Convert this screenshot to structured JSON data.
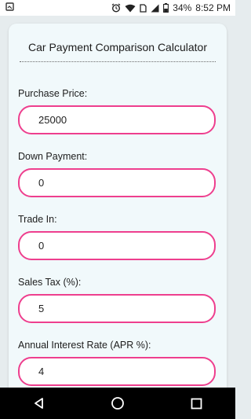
{
  "status_bar": {
    "battery_percent": "34%",
    "time": "8:52 PM",
    "icons": [
      "notification-icon",
      "alarm-icon",
      "wifi-icon",
      "sim-icon",
      "signal-icon",
      "battery-icon"
    ]
  },
  "app": {
    "title": "Car Payment Comparison Calculator",
    "accent_color": "#ee3f8e"
  },
  "fields": [
    {
      "label": "Purchase Price:",
      "value": "25000"
    },
    {
      "label": "Down Payment:",
      "value": "0"
    },
    {
      "label": "Trade In:",
      "value": "0"
    },
    {
      "label": "Sales Tax (%):",
      "value": "5"
    },
    {
      "label": "Annual Interest Rate (APR %):",
      "value": "4"
    }
  ],
  "nav_bar": {
    "icons": [
      "back-icon",
      "home-icon",
      "recents-icon"
    ]
  }
}
